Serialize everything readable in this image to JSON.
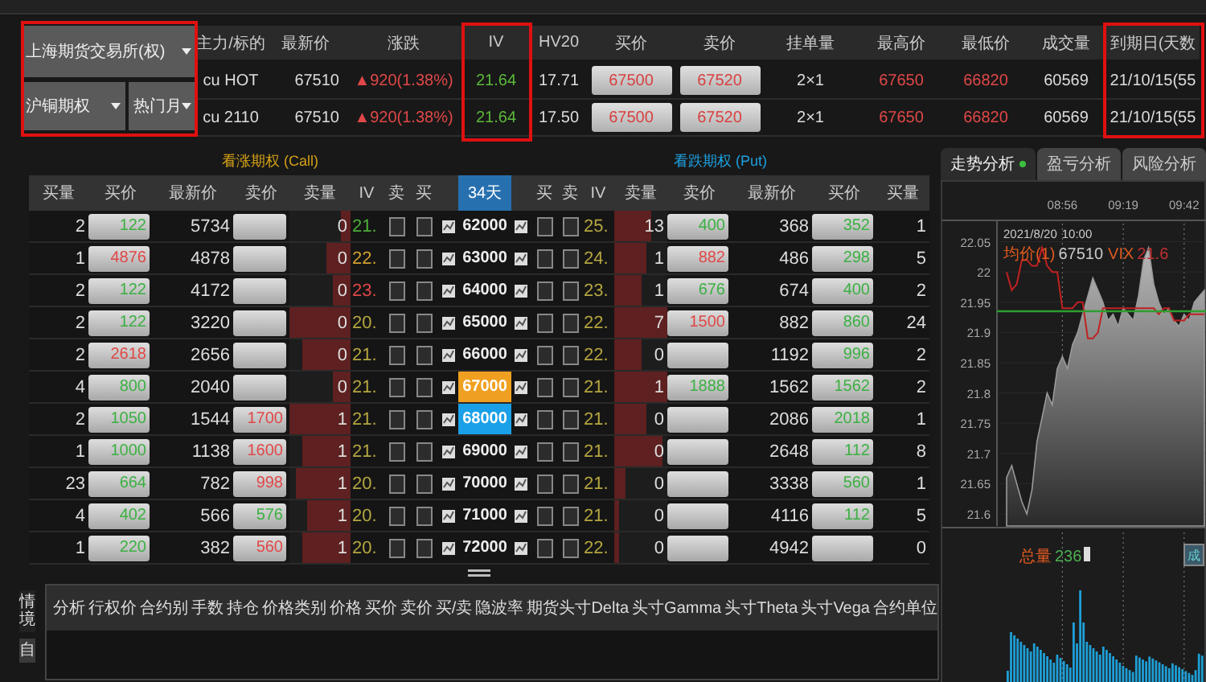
{
  "selectors": {
    "exchange": "上海期货交易所(权)",
    "product": "沪铜期权",
    "month": "热门月"
  },
  "quote_table": {
    "columns": [
      "主力/标的",
      "最新价",
      "涨跌",
      "IV",
      "HV20",
      "买价",
      "卖价",
      "挂单量",
      "最高价",
      "最低价",
      "成交量",
      "到期日(天数"
    ],
    "rows": [
      {
        "symbol": "cu HOT",
        "last": "67510",
        "change": "▲920(1.38%)",
        "iv": "21.64",
        "hv20": "17.71",
        "bid": "67500",
        "ask": "67520",
        "depth": "2×1",
        "high": "67650",
        "low": "66820",
        "volume": "60569",
        "expiry": "21/10/15(55"
      },
      {
        "symbol": "cu 2110",
        "last": "67510",
        "change": "▲920(1.38%)",
        "iv": "21.64",
        "hv20": "17.50",
        "bid": "67500",
        "ask": "67520",
        "depth": "2×1",
        "high": "67650",
        "low": "66820",
        "volume": "60569",
        "expiry": "21/10/15(55"
      }
    ]
  },
  "highlights": [
    {
      "kind": "selectors"
    },
    {
      "kind": "iv"
    },
    {
      "kind": "expiry"
    }
  ],
  "option_chain": {
    "call_title": "看涨期权 (Call)",
    "put_title": "看跌期权 (Put)",
    "days": "34天",
    "call_columns": [
      "买量",
      "买价",
      "最新价",
      "卖价",
      "卖量",
      "IV",
      "卖",
      "买"
    ],
    "put_columns": [
      "买",
      "卖",
      "IV",
      "卖量",
      "卖价",
      "最新价",
      "买价",
      "买量"
    ],
    "rows": [
      {
        "strike": "62000",
        "atm": false,
        "selected": false,
        "call": {
          "bid_qty": "2",
          "bid": {
            "text": "122",
            "color": "#3cb043"
          },
          "last": "5734",
          "ask_qty": "0",
          "iv": {
            "text": "21.",
            "color": "#4caf38"
          },
          "level": 0.15,
          "sell_checked": false,
          "buy_checked": false
        },
        "put": {
          "buy_checked": false,
          "sell_checked": false,
          "iv": {
            "text": "25.",
            "color": "#b5a640"
          },
          "level": 0.7,
          "ask_qty": "13",
          "ask": {
            "text": "400",
            "color": "#3cb043"
          },
          "last": "368",
          "bid": {
            "text": "352",
            "color": "#3cb043"
          },
          "bid_qty": "1"
        }
      },
      {
        "strike": "63000",
        "atm": false,
        "selected": false,
        "call": {
          "bid_qty": "1",
          "bid": {
            "text": "4876",
            "color": "#e04848"
          },
          "last": "4878",
          "ask_qty": "0",
          "iv": {
            "text": "22.",
            "color": "#d0a030"
          },
          "level": 0.4,
          "sell_checked": false,
          "buy_checked": false
        },
        "put": {
          "buy_checked": false,
          "sell_checked": false,
          "iv": {
            "text": "24.",
            "color": "#b5a640"
          },
          "level": 0.6,
          "ask_qty": "1",
          "ask": {
            "text": "882",
            "color": "#e04848"
          },
          "last": "486",
          "bid": {
            "text": "298",
            "color": "#3cb043"
          },
          "bid_qty": "5"
        }
      },
      {
        "strike": "64000",
        "atm": false,
        "selected": false,
        "call": {
          "bid_qty": "2",
          "bid": {
            "text": "122",
            "color": "#3cb043"
          },
          "last": "4172",
          "ask_qty": "0",
          "iv": {
            "text": "23.",
            "color": "#e04848"
          },
          "level": 0.3,
          "sell_checked": false,
          "buy_checked": false
        },
        "put": {
          "buy_checked": false,
          "sell_checked": false,
          "iv": {
            "text": "23.",
            "color": "#b5a640"
          },
          "level": 0.5,
          "ask_qty": "1",
          "ask": {
            "text": "676",
            "color": "#3cb043"
          },
          "last": "674",
          "bid": {
            "text": "400",
            "color": "#3cb043"
          },
          "bid_qty": "2"
        }
      },
      {
        "strike": "65000",
        "atm": false,
        "selected": false,
        "call": {
          "bid_qty": "2",
          "bid": {
            "text": "122",
            "color": "#3cb043"
          },
          "last": "3220",
          "ask_qty": "0",
          "iv": {
            "text": "20.",
            "color": "#b5a640"
          },
          "level": 1.0,
          "sell_checked": false,
          "buy_checked": false
        },
        "put": {
          "buy_checked": false,
          "sell_checked": false,
          "iv": {
            "text": "22.",
            "color": "#b5a640"
          },
          "level": 1.0,
          "ask_qty": "7",
          "ask": {
            "text": "1500",
            "color": "#e04848"
          },
          "last": "882",
          "bid": {
            "text": "860",
            "color": "#3cb043"
          },
          "bid_qty": "24"
        }
      },
      {
        "strike": "66000",
        "atm": false,
        "selected": false,
        "call": {
          "bid_qty": "2",
          "bid": {
            "text": "2618",
            "color": "#e04848"
          },
          "last": "2656",
          "ask_qty": "0",
          "iv": {
            "text": "21.",
            "color": "#b5a640"
          },
          "level": 0.8,
          "sell_checked": false,
          "buy_checked": false
        },
        "put": {
          "buy_checked": false,
          "sell_checked": false,
          "iv": {
            "text": "22.",
            "color": "#b5a640"
          },
          "level": 0.5,
          "ask_qty": "0",
          "last": "1192",
          "bid": {
            "text": "996",
            "color": "#3cb043"
          },
          "bid_qty": "2"
        }
      },
      {
        "strike": "67000",
        "atm": true,
        "selected": false,
        "call": {
          "bid_qty": "4",
          "bid": {
            "text": "800",
            "color": "#3cb043"
          },
          "last": "2040",
          "ask_qty": "0",
          "iv": {
            "text": "21.",
            "color": "#b5a640"
          },
          "level": 0.3,
          "sell_checked": false,
          "buy_checked": false
        },
        "put": {
          "buy_checked": false,
          "sell_checked": false,
          "iv": {
            "text": "21.",
            "color": "#b5a640"
          },
          "level": 1.0,
          "ask_qty": "1",
          "ask": {
            "text": "1888",
            "color": "#3cb043"
          },
          "last": "1562",
          "bid": {
            "text": "1562",
            "color": "#3cb043"
          },
          "bid_qty": "2"
        }
      },
      {
        "strike": "68000",
        "atm": false,
        "selected": true,
        "call": {
          "bid_qty": "2",
          "bid": {
            "text": "1050",
            "color": "#3cb043"
          },
          "last": "1544",
          "ask": {
            "text": "1700",
            "color": "#e04848"
          },
          "ask_qty": "1",
          "iv": {
            "text": "21.",
            "color": "#b5a640"
          },
          "level": 1.0,
          "sell_checked": false,
          "buy_checked": false
        },
        "put": {
          "buy_checked": false,
          "sell_checked": false,
          "iv": {
            "text": "21.",
            "color": "#b5a640"
          },
          "level": 0.6,
          "ask_qty": "0",
          "last": "2086",
          "bid": {
            "text": "2018",
            "color": "#3cb043"
          },
          "bid_qty": "1"
        }
      },
      {
        "strike": "69000",
        "atm": false,
        "selected": false,
        "call": {
          "bid_qty": "1",
          "bid": {
            "text": "1000",
            "color": "#3cb043"
          },
          "last": "1138",
          "ask": {
            "text": "1600",
            "color": "#e04848"
          },
          "ask_qty": "1",
          "iv": {
            "text": "21.",
            "color": "#b5a640"
          },
          "level": 0.8,
          "sell_checked": false,
          "buy_checked": false
        },
        "put": {
          "buy_checked": false,
          "sell_checked": false,
          "iv": {
            "text": "21.",
            "color": "#b5a640"
          },
          "level": 0.9,
          "ask_qty": "0",
          "last": "2648",
          "bid": {
            "text": "112",
            "color": "#3cb043"
          },
          "bid_qty": "8"
        }
      },
      {
        "strike": "70000",
        "atm": false,
        "selected": false,
        "call": {
          "bid_qty": "23",
          "bid": {
            "text": "664",
            "color": "#3cb043"
          },
          "last": "782",
          "ask": {
            "text": "998",
            "color": "#e04848"
          },
          "ask_qty": "1",
          "iv": {
            "text": "20.",
            "color": "#b5a640"
          },
          "level": 0.9,
          "sell_checked": false,
          "buy_checked": false
        },
        "put": {
          "buy_checked": false,
          "sell_checked": false,
          "iv": {
            "text": "21.",
            "color": "#b5a640"
          },
          "level": 0.2,
          "ask_qty": "0",
          "last": "3338",
          "bid": {
            "text": "560",
            "color": "#3cb043"
          },
          "bid_qty": "1"
        }
      },
      {
        "strike": "71000",
        "atm": false,
        "selected": false,
        "call": {
          "bid_qty": "4",
          "bid": {
            "text": "402",
            "color": "#3cb043"
          },
          "last": "566",
          "ask": {
            "text": "576",
            "color": "#3cb043"
          },
          "ask_qty": "1",
          "iv": {
            "text": "20.",
            "color": "#b5a640"
          },
          "level": 0.7,
          "sell_checked": false,
          "buy_checked": false
        },
        "put": {
          "buy_checked": false,
          "sell_checked": false,
          "iv": {
            "text": "21.",
            "color": "#b5a640"
          },
          "level": 0.1,
          "ask_qty": "0",
          "last": "4116",
          "bid": {
            "text": "112",
            "color": "#3cb043"
          },
          "bid_qty": "5"
        }
      },
      {
        "strike": "72000",
        "atm": false,
        "selected": false,
        "call": {
          "bid_qty": "1",
          "bid": {
            "text": "220",
            "color": "#3cb043"
          },
          "last": "382",
          "ask": {
            "text": "560",
            "color": "#e04848"
          },
          "ask_qty": "1",
          "iv": {
            "text": "20.",
            "color": "#b5a640"
          },
          "level": 0.8,
          "sell_checked": false,
          "buy_checked": false
        },
        "put": {
          "buy_checked": false,
          "sell_checked": false,
          "iv": {
            "text": "22.",
            "color": "#b5a640"
          },
          "level": 0.1,
          "ask_qty": "0",
          "last": "4942",
          "bid_qty": "0"
        }
      }
    ]
  },
  "analysis": {
    "tabs": [
      {
        "label": "走势分析",
        "selected": true,
        "live": true
      },
      {
        "label": "盈亏分析",
        "selected": false,
        "live": false
      },
      {
        "label": "风险分析",
        "selected": false,
        "live": false
      }
    ],
    "legend": {
      "date": "2021/8/20",
      "time": "10:00",
      "avg_value": "67510",
      "vix_value": "21.6"
    },
    "chart_data": {
      "type": "area",
      "categories": [
        null,
        null,
        null,
        null,
        null,
        null,
        null,
        null,
        null,
        null,
        null,
        "08:56",
        null,
        null,
        null,
        null,
        null,
        null,
        null,
        null,
        null,
        null,
        null,
        "09:19",
        null,
        null,
        null,
        null,
        null,
        null,
        null,
        null,
        null,
        null,
        null,
        "09:42",
        null,
        null,
        null,
        null
      ],
      "ylim": [
        21.58,
        22.08
      ],
      "yticks": [
        {
          "value": 22.05,
          "label": "22.05"
        },
        {
          "value": 22,
          "label": "22"
        },
        {
          "value": 21.95,
          "label": "21.95"
        },
        {
          "value": 21.9,
          "label": "21.9"
        },
        {
          "value": 21.85,
          "label": "21.85"
        },
        {
          "value": 21.8,
          "label": "21.8"
        },
        {
          "value": 21.75,
          "label": "21.75"
        },
        {
          "value": 21.7,
          "label": "21.7"
        },
        {
          "value": 21.65,
          "label": "21.65"
        },
        {
          "value": 21.6,
          "label": "21.6"
        }
      ],
      "series": [
        {
          "name": "VIX",
          "color": "#9a9a9a",
          "values": [
            21.66,
            21.68,
            21.65,
            21.62,
            21.6,
            21.64,
            21.72,
            21.76,
            21.8,
            21.78,
            21.84,
            21.86,
            21.84,
            21.88,
            21.9,
            21.93,
            21.96,
            21.99,
            21.97,
            21.95,
            21.92,
            21.93,
            21.91,
            21.94,
            21.93,
            21.92,
            21.96,
            22.02,
            22.04,
            21.98,
            21.95,
            21.93,
            21.94,
            21.92,
            21.91,
            21.93,
            21.92,
            21.95,
            21.96,
            21.97
          ]
        },
        {
          "name": "均价(1)",
          "type": "line",
          "color": "#c02020",
          "values": [
            22.0,
            21.97,
            21.98,
            22.02,
            22.02,
            22.01,
            22.01,
            22.04,
            22.01,
            22.0,
            22.0,
            21.94,
            21.94,
            21.94,
            21.95,
            21.95,
            21.89,
            21.89,
            21.9,
            21.94,
            21.94,
            21.94,
            21.94,
            21.94,
            21.94,
            21.94,
            21.94,
            21.94,
            21.94,
            21.94,
            21.93,
            21.94,
            21.94,
            21.92,
            21.92,
            21.92,
            21.93,
            21.93,
            21.93,
            21.93
          ]
        }
      ],
      "grid": true,
      "ref_lines": [
        {
          "axis": "y",
          "value": 21.935,
          "color": "#2e9e2e"
        }
      ]
    },
    "volume": {
      "label": "总量",
      "value": "236",
      "button": "成"
    }
  },
  "scenario": {
    "side_tabs": [
      {
        "label": "情境",
        "selected": true
      },
      {
        "label": "自",
        "selected": false
      }
    ],
    "columns": [
      "分析",
      "行权价",
      "合约别",
      "手数",
      "持仓",
      "价格类别",
      "价格",
      "买价",
      "卖价",
      "买/卖",
      "隐波率",
      "期货头寸Delta",
      "头寸Gamma",
      "头寸Theta",
      "头寸Vega",
      "合约单位"
    ]
  }
}
